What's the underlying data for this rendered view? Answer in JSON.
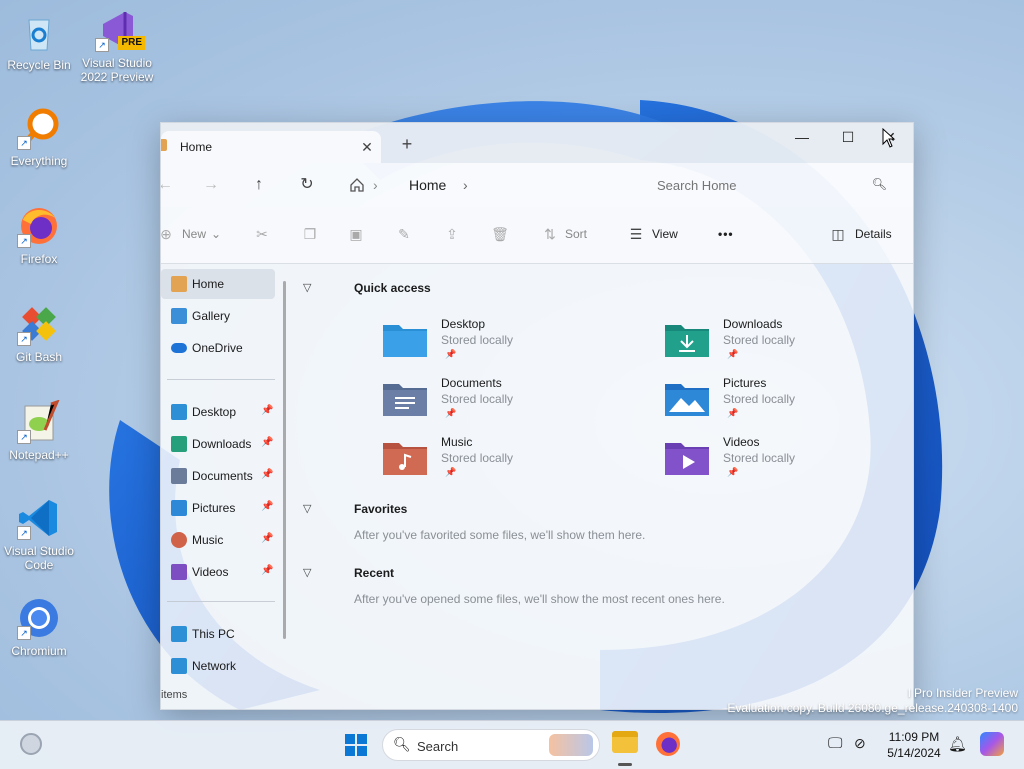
{
  "desktop": {
    "icons": [
      {
        "label": "Recycle Bin"
      },
      {
        "label": "Visual Studio 2022 Preview",
        "badge": "PRE"
      },
      {
        "label": "Everything"
      },
      {
        "label": "Firefox"
      },
      {
        "label": "Git Bash"
      },
      {
        "label": "Notepad++"
      },
      {
        "label": "Visual Studio Code"
      },
      {
        "label": "Chromium"
      }
    ]
  },
  "window": {
    "tab": {
      "label": "Home",
      "close": "✕"
    },
    "new_tab": "+",
    "caption": {
      "minimize": "—",
      "maximize": "☐",
      "close": "✕"
    },
    "nav": {
      "back": "←",
      "forward": "→",
      "up": "↑",
      "refresh": "↻",
      "home_icon": "home-icon",
      "crumb": "Home",
      "sep": "›"
    },
    "search_placeholder": "Search Home",
    "commands": {
      "new": "New",
      "sort": "Sort",
      "view": "View",
      "more": "•••",
      "details": "Details"
    },
    "sidebar": [
      {
        "label": "Home",
        "color": "#e2a452"
      },
      {
        "label": "Gallery",
        "color": "#3b8fd8"
      },
      {
        "label": "OneDrive",
        "color": "#1e73d6"
      },
      {
        "label": "Desktop",
        "color": "#2d8fd6",
        "pin": "📌"
      },
      {
        "label": "Downloads",
        "color": "#25a07a",
        "pin": "📌"
      },
      {
        "label": "Documents",
        "color": "#6b7c9a",
        "pin": "📌"
      },
      {
        "label": "Pictures",
        "color": "#2e88d8",
        "pin": "📌"
      },
      {
        "label": "Music",
        "color": "#d0624a",
        "pin": "📌"
      },
      {
        "label": "Videos",
        "color": "#7c4ec2",
        "pin": "📌"
      },
      {
        "label": "This PC",
        "color": "#2d8fd6"
      },
      {
        "label": "Network",
        "color": "#2d8fd6"
      }
    ],
    "quick_access": {
      "title": "Quick access",
      "items": [
        {
          "name": "Desktop",
          "sub": "Stored locally",
          "color": "#2b8fd6"
        },
        {
          "name": "Downloads",
          "sub": "Stored locally",
          "color": "#1f9e8a"
        },
        {
          "name": "Documents",
          "sub": "Stored locally",
          "color": "#6b7fa6"
        },
        {
          "name": "Pictures",
          "sub": "Stored locally",
          "color": "#2e88d8"
        },
        {
          "name": "Music",
          "sub": "Stored locally",
          "color": "#d06a52"
        },
        {
          "name": "Videos",
          "sub": "Stored locally",
          "color": "#8152c9"
        }
      ]
    },
    "favorites": {
      "title": "Favorites",
      "note": "After you've favorited some files, we'll show them here."
    },
    "recent": {
      "title": "Recent",
      "note": "After you've opened some files, we'll show the most recent ones here."
    },
    "status": "items"
  },
  "taskbar": {
    "search_label": "Search",
    "time": "11:09 PM",
    "date": "5/14/2024"
  },
  "watermark": {
    "line1": "l Pro Insider Preview",
    "line2": "Evaluation copy. Build 26080.ge_release.240308-1400"
  }
}
